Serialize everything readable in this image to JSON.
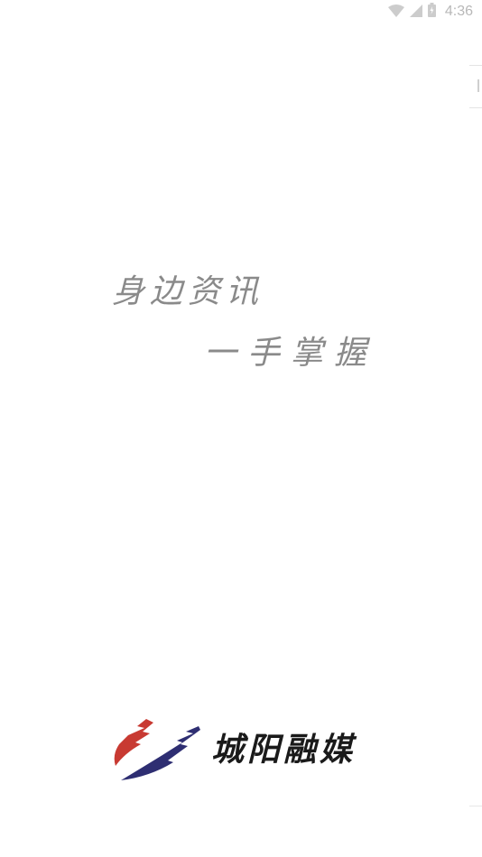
{
  "status_bar": {
    "time": "4:36",
    "icons": [
      "wifi-icon",
      "cell-signal-icon",
      "battery-icon"
    ]
  },
  "slogan": {
    "line1": "身边资讯",
    "line2": "一手掌握"
  },
  "brand": {
    "name": "城阳融媒",
    "logo_colors": {
      "red": "#c83a32",
      "navy": "#2e2e72"
    }
  },
  "colors": {
    "background": "#ffffff",
    "slogan_text": "#8a8a8a",
    "brand_text": "#1a1a1a",
    "status_text": "#b8b8b8"
  }
}
